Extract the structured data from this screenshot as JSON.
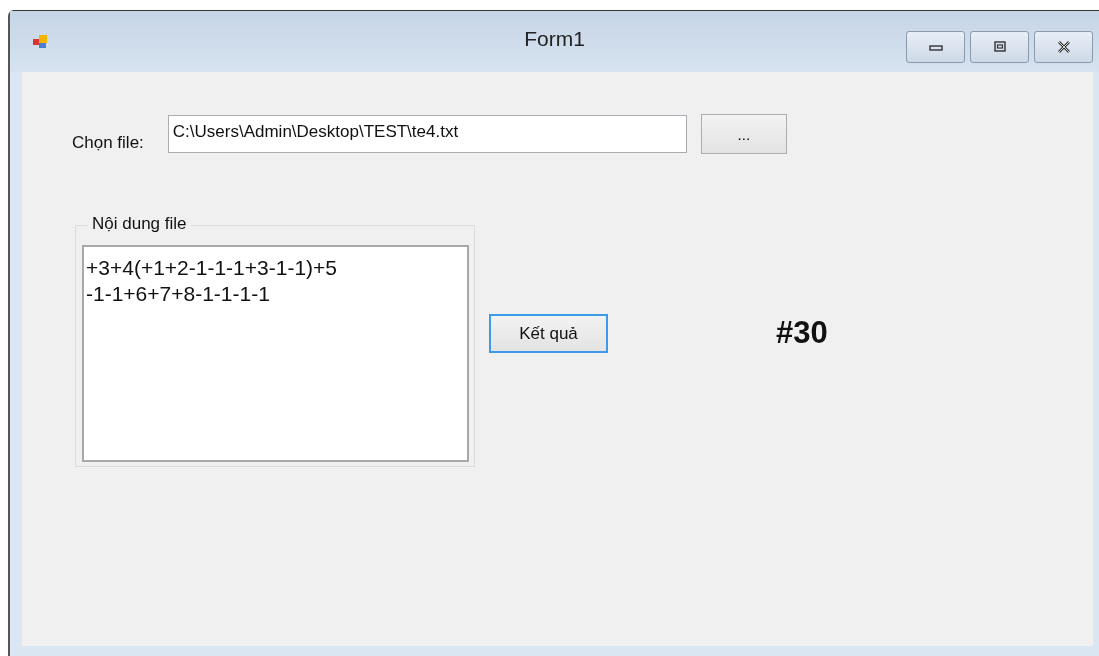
{
  "window": {
    "title": "Form1"
  },
  "file_picker": {
    "label": "Chọn file:",
    "value": "C:\\Users\\Admin\\Desktop\\TEST\\te4.txt",
    "browse_button": "..."
  },
  "content_group": {
    "legend": "Nội dung file",
    "text": "+3+4(+1+2-1-1-1+3-1-1)+5\n-1-1+6+7+8-1-1-1-1"
  },
  "result_button": {
    "label": "Kết quả",
    "focused": true
  },
  "result": "#30"
}
